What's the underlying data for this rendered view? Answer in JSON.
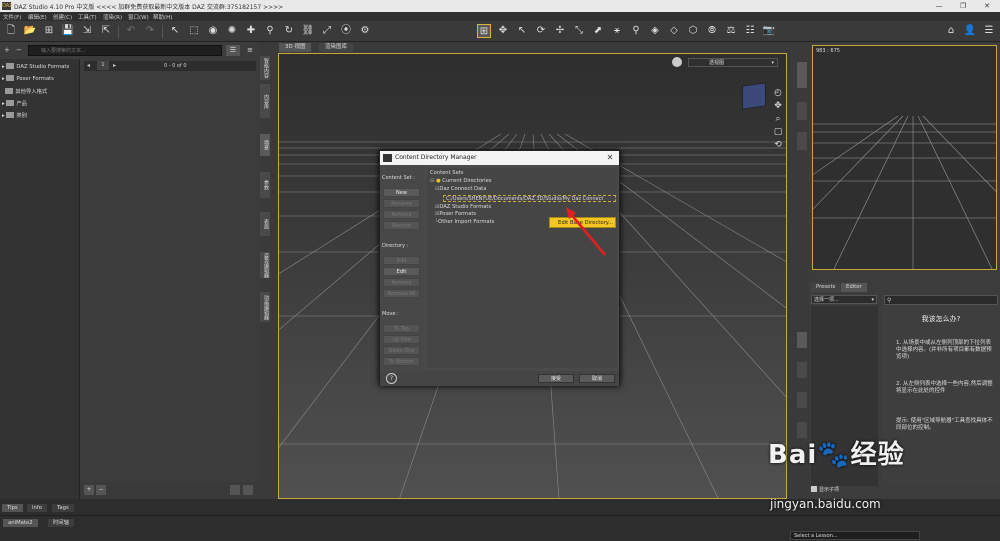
{
  "window": {
    "title": "DAZ Studio 4.10 Pro 中文版   <<<<  加群免费获取最新中文版本 DAZ 交流群:375182157  >>>>",
    "logo": "DAZ",
    "controls": [
      "—",
      "❐",
      "✕"
    ]
  },
  "menubar": {
    "items": [
      "文件(F)",
      "编辑(E)",
      "创建(C)",
      "工具(T)",
      "渲染(R)",
      "窗口(W)",
      "帮助(H)"
    ]
  },
  "toolbar": {
    "left_icons": [
      "new-icon",
      "open-icon",
      "save-icon",
      "save-as-icon",
      "import-icon",
      "export-icon",
      "undo-icon",
      "redo-icon"
    ],
    "right_icons": [
      "home-icon",
      "user-icon",
      "menu-icon"
    ]
  },
  "left_panel": {
    "search_placeholder": "输入要搜索的文本...",
    "tree": [
      {
        "label": "DAZ Studio Formats"
      },
      {
        "label": "Poser Formats"
      },
      {
        "label": "其他导入格式"
      },
      {
        "label": "产品"
      },
      {
        "label": "类别"
      }
    ],
    "pager": {
      "page": "1",
      "range": "0 - 0 of 0"
    },
    "bottom_tabs": [
      {
        "label": "Tips"
      },
      {
        "label": "Info"
      },
      {
        "label": "Tags"
      }
    ],
    "side_tabs": [
      "智能内容",
      "内容库",
      "场景",
      "参数",
      "表面",
      "姿势编辑器",
      "动画编辑器"
    ]
  },
  "viewport": {
    "tabs": [
      {
        "label": "3D 视图"
      },
      {
        "label": "渲染图库"
      }
    ],
    "camera_select": "透视图",
    "nav_icons": [
      "◴",
      "✥",
      "⌕",
      "▢",
      "⟲"
    ]
  },
  "dialog": {
    "title": "Content Directory Manager",
    "close_symbol": "✕",
    "content_set": {
      "label": "Content Set :",
      "buttons": [
        {
          "label": "New",
          "enabled": true
        },
        {
          "label": "Rename",
          "enabled": false
        },
        {
          "label": "Remove",
          "enabled": false
        },
        {
          "label": "Restore",
          "enabled": false
        }
      ]
    },
    "directory": {
      "label": "Directory :",
      "buttons": [
        {
          "label": "Add",
          "enabled": false
        },
        {
          "label": "Edit",
          "enabled": true
        },
        {
          "label": "Remove",
          "enabled": false
        },
        {
          "label": "Remove All",
          "enabled": false
        }
      ]
    },
    "move": {
      "label": "Move :",
      "buttons": [
        {
          "label": "To Top",
          "enabled": false
        },
        {
          "label": "Up One",
          "enabled": false
        },
        {
          "label": "Down One",
          "enabled": false
        },
        {
          "label": "To Bottom",
          "enabled": false
        }
      ]
    },
    "tree": {
      "root": "Content Sets",
      "current": "Current Directories",
      "daz_connect": "Daz Connect Data",
      "path": "C:/Users/SHENYUE/Documents/DAZ 3D/Studio/My Daz Connect",
      "studio_formats": "DAZ Studio Formats",
      "poser_formats": "Poser Formats",
      "other_import": "Other Import Formats"
    },
    "context_menu": "Edit Base Directory...",
    "footer": {
      "help": "?",
      "accept": "接受",
      "cancel": "取消"
    }
  },
  "right_panel": {
    "aux_coord": "983 : 675",
    "tabs": [
      {
        "label": "Presets"
      },
      {
        "label": "Editor"
      }
    ],
    "select_value": "选择一项...",
    "help_title": "我该怎么办?",
    "help_steps": [
      "1. 从场景中或从左侧列顶部的下拉列表中选择内容。(并非所有项目都有数据预览项)",
      "2. 从左侧列表中选择一些内容,然后调整将显示在此处的控件",
      "提示: 使用\"区域导航器\"工具查找具体不同部位的控制。"
    ],
    "show_subitems": "显示子项"
  },
  "bottom": {
    "tabs": [
      {
        "label": "aniMate2"
      },
      {
        "label": "时间轴"
      }
    ],
    "lesson_placeholder": "Select a Lesson..."
  },
  "watermark": {
    "logo": "Bai🐾经验",
    "url": "jingyan.baidu.com"
  },
  "colors": {
    "accent": "#caa83a",
    "highlight": "#f3c624",
    "arrow": "#e02020"
  }
}
